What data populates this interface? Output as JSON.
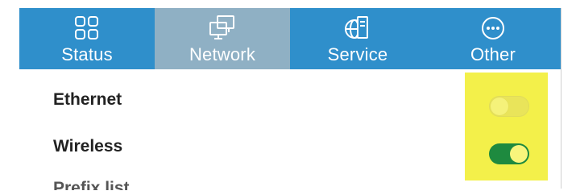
{
  "nav": {
    "tabs": [
      {
        "label": "Status",
        "icon": "grid-icon",
        "active": false
      },
      {
        "label": "Network",
        "icon": "monitors-icon",
        "active": true
      },
      {
        "label": "Service",
        "icon": "globe-server-icon",
        "active": false
      },
      {
        "label": "Other",
        "icon": "more-dots-icon",
        "active": false
      }
    ]
  },
  "settings": {
    "rows": [
      {
        "label": "Ethernet",
        "toggle_on": false
      },
      {
        "label": "Wireless",
        "toggle_on": true
      },
      {
        "label": "Prefix list",
        "partially_visible": true
      }
    ]
  },
  "colors": {
    "nav_bg": "#2f8fcb",
    "nav_active_bg": "#8fb0c4",
    "highlight": "#f3f04a",
    "toggle_on": "#1e8a3f"
  }
}
